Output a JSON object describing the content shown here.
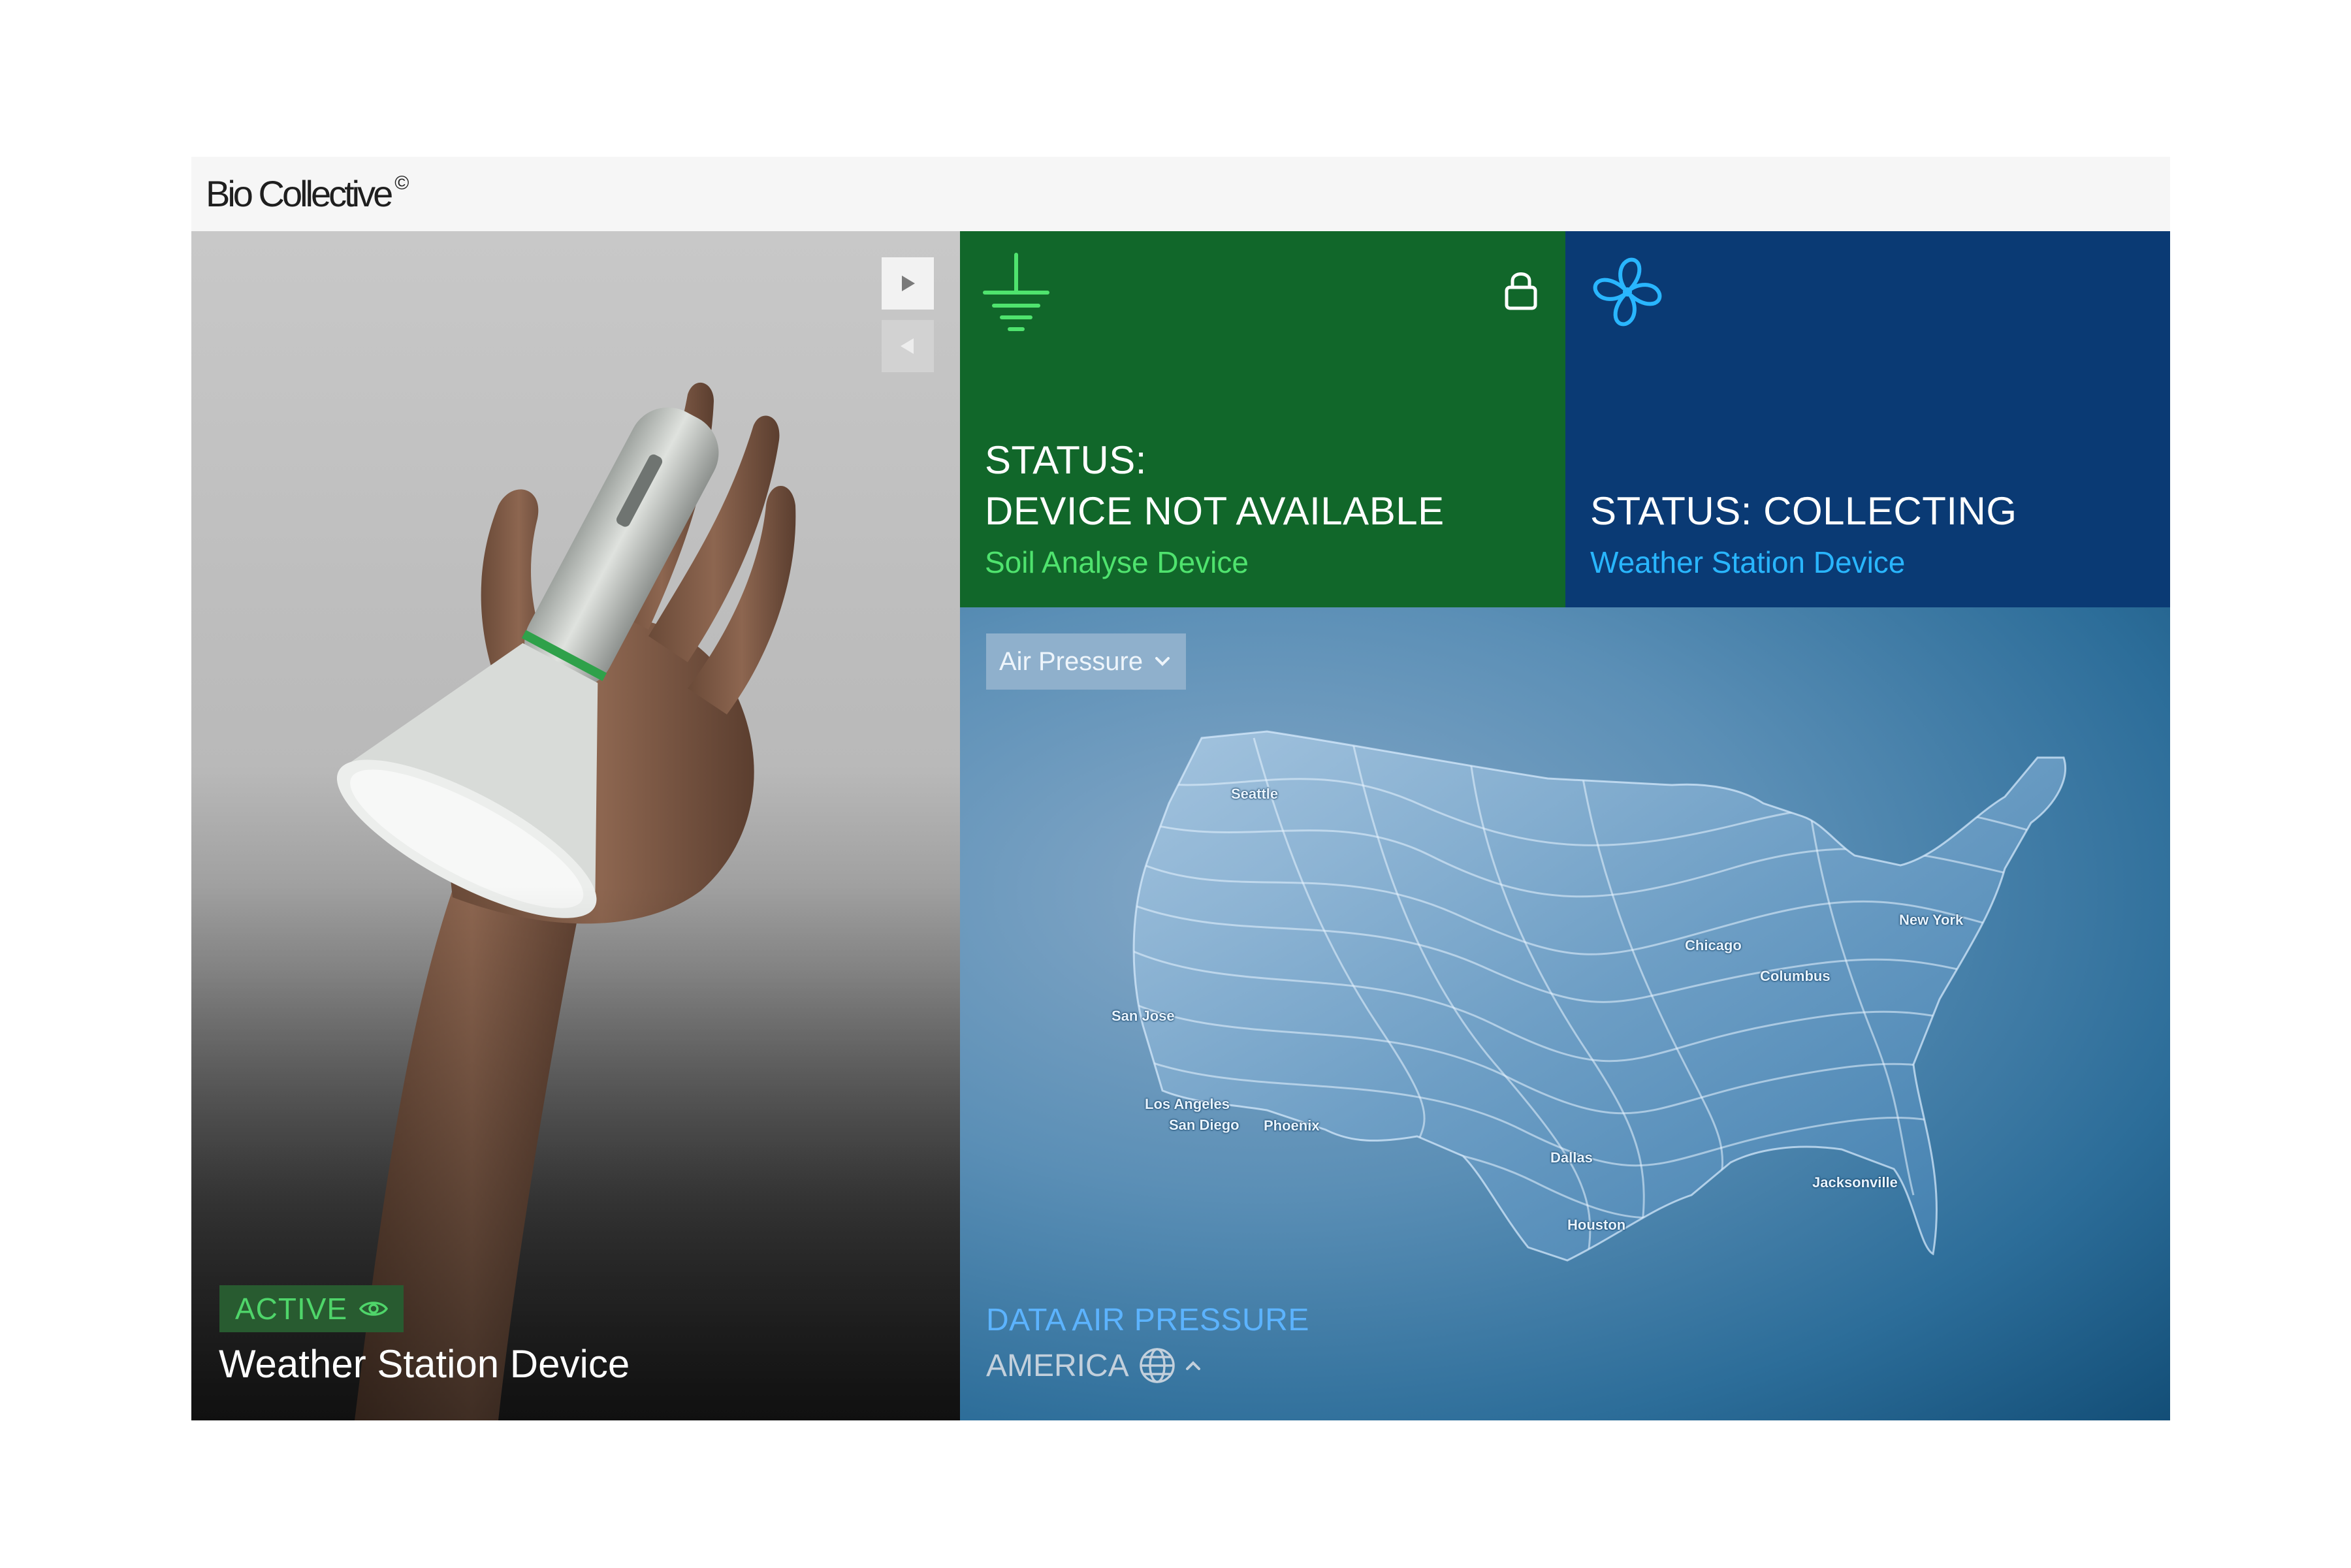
{
  "header": {
    "brand": "Bio Collective",
    "brand_mark": "©"
  },
  "photo_panel": {
    "badge": "ACTIVE",
    "title": "Weather Station Device",
    "nav": {
      "next_icon": "play-right-icon",
      "prev_icon": "play-left-icon"
    }
  },
  "tiles": {
    "soil": {
      "status_line1": "STATUS:",
      "status_line2": "DEVICE NOT AVAILABLE",
      "subtitle": "Soil Analyse Device",
      "icon": "ground-icon",
      "lock_icon": "lock-icon"
    },
    "weather": {
      "status": "STATUS: COLLECTING",
      "subtitle": "Weather Station Device",
      "icon": "fan-icon"
    }
  },
  "map_panel": {
    "dropdown_value": "Air Pressure",
    "data_label": "DATA AIR PRESSURE",
    "region": "AMERICA",
    "cities": {
      "seattle": "Seattle",
      "sanjose": "San Jose",
      "losangeles": "Los Angeles",
      "sandiego": "San Diego",
      "phoenix": "Phoenix",
      "dallas": "Dallas",
      "houston": "Houston",
      "chicago": "Chicago",
      "columbus": "Columbus",
      "newyork": "New York",
      "jacksonville": "Jacksonville"
    }
  },
  "colors": {
    "soil_tile": "#11672a",
    "weather_tile": "#0a3a74",
    "accent_green": "#4fe36e",
    "accent_blue": "#29b6ff"
  }
}
